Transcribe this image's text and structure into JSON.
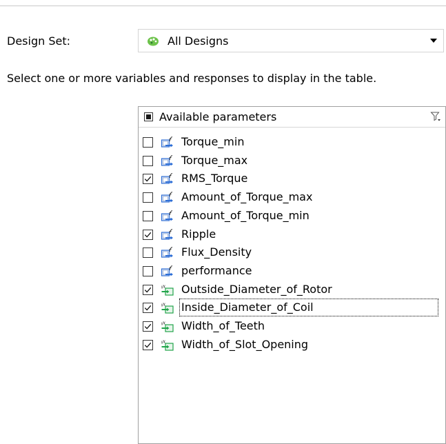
{
  "design_set": {
    "label": "Design Set:",
    "value": "All Designs",
    "icon": "design-set-icon"
  },
  "instruction": "Select one or more variables and responses to display in the table.",
  "parameters": {
    "header_label": "Available parameters",
    "header_check_state": "indeterminate",
    "header_filter_icon": "filter-icon",
    "items": [
      {
        "label": "Torque_min",
        "checked": false,
        "kind": "response"
      },
      {
        "label": "Torque_max",
        "checked": false,
        "kind": "response"
      },
      {
        "label": "RMS_Torque",
        "checked": true,
        "kind": "response"
      },
      {
        "label": "Amount_of_Torque_max",
        "checked": false,
        "kind": "response"
      },
      {
        "label": "Amount_of_Torque_min",
        "checked": false,
        "kind": "response"
      },
      {
        "label": "Ripple",
        "checked": true,
        "kind": "response"
      },
      {
        "label": "Flux_Density",
        "checked": false,
        "kind": "response"
      },
      {
        "label": "performance",
        "checked": false,
        "kind": "response"
      },
      {
        "label": "Outside_Diameter_of_Rotor",
        "checked": true,
        "kind": "variable"
      },
      {
        "label": "Inside_Diameter_of_Coil",
        "checked": true,
        "kind": "variable",
        "focused": true
      },
      {
        "label": "Width_of_Teeth",
        "checked": true,
        "kind": "variable"
      },
      {
        "label": "Width_of_Slot_Opening",
        "checked": true,
        "kind": "variable"
      }
    ]
  },
  "colors": {
    "response_icon_blue": "#2f6fd6",
    "variable_icon_green": "#21a44a",
    "border": "#a0a0a0"
  }
}
